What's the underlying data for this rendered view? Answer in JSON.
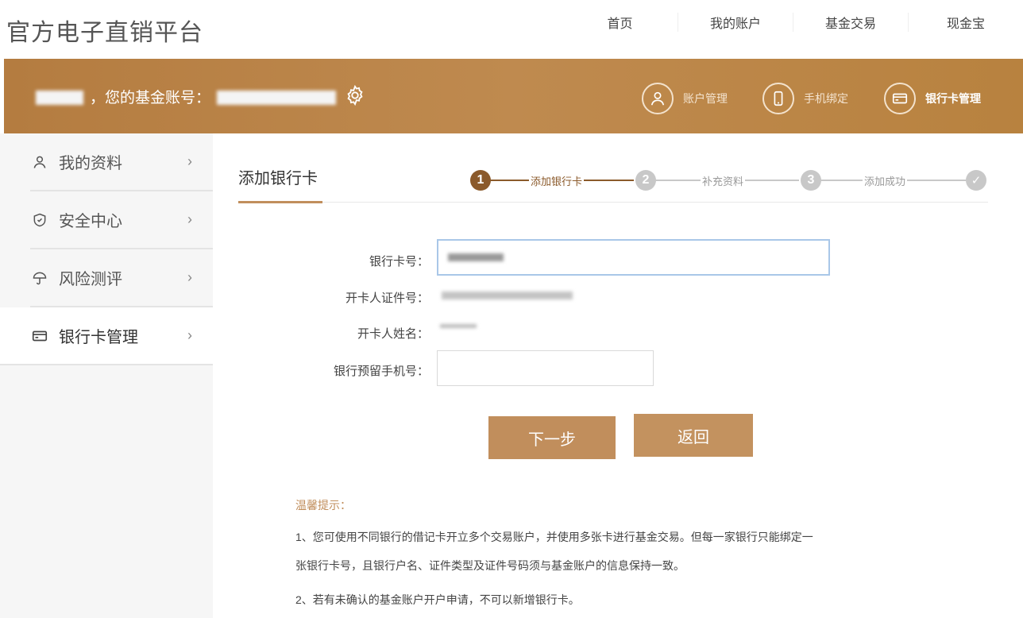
{
  "site": {
    "title": "官方电子直销平台"
  },
  "top_nav": {
    "items": [
      "首页",
      "我的账户",
      "基金交易",
      "现金宝"
    ]
  },
  "banner": {
    "account_label": "，您的基金账号：",
    "quick_links": [
      {
        "label": "账户管理",
        "icon": "user-icon"
      },
      {
        "label": "手机绑定",
        "icon": "phone-icon"
      },
      {
        "label": "银行卡管理",
        "icon": "card-icon"
      }
    ]
  },
  "sidebar": {
    "items": [
      {
        "label": "我的资料",
        "icon": "user-icon"
      },
      {
        "label": "安全中心",
        "icon": "shield-icon"
      },
      {
        "label": "风险测评",
        "icon": "umbrella-icon"
      },
      {
        "label": "银行卡管理",
        "icon": "card-icon",
        "active": true
      }
    ],
    "chevron": "›"
  },
  "main": {
    "title": "添加银行卡",
    "steps": [
      {
        "number": "1",
        "label": "添加银行卡",
        "active": true
      },
      {
        "number": "2",
        "label": "补充资料",
        "active": false
      },
      {
        "number": "3",
        "label": "添加成功",
        "active": false
      },
      {
        "number": "✓",
        "label": "",
        "active": false
      }
    ],
    "form": {
      "card_number_label": "银行卡号：",
      "id_number_label": "开卡人证件号：",
      "name_label": "开卡人姓名：",
      "phone_label": "银行预留手机号："
    },
    "buttons": {
      "next": "下一步",
      "back": "返回"
    },
    "tips": {
      "title": "温馨提示：",
      "line1": "1、您可使用不同银行的借记卡开立多个交易账户，并使用多张卡进行基金交易。但每一家银行只能绑定一",
      "line1b": "张银行卡号，且银行户名、证件类型及证件号码须与基金账户的信息保持一致。",
      "line2": "2、若有未确认的基金账户开户申请，不可以新增银行卡。"
    }
  },
  "colors": {
    "accent": "#c18e5c",
    "banner": "#b8823f",
    "step_inactive": "#c8c8c8",
    "step_active": "#8b5a2b"
  }
}
